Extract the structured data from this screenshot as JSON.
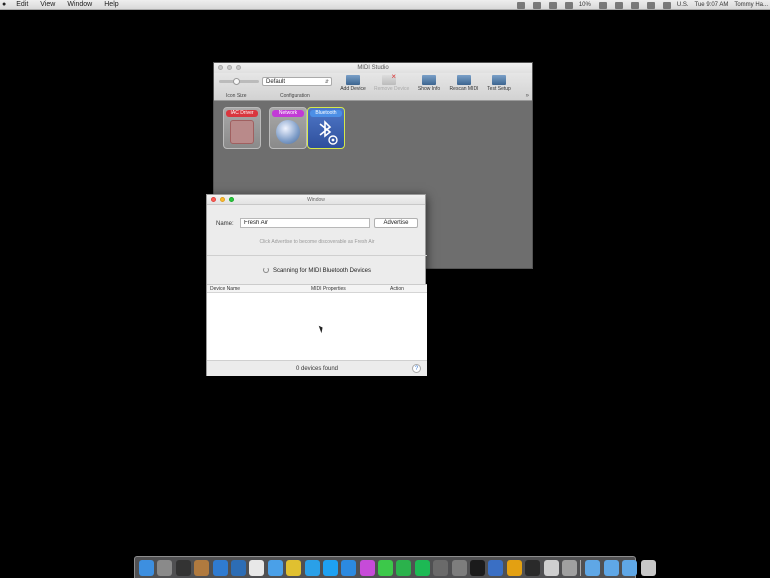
{
  "menubar": {
    "items": [
      "Edit",
      "View",
      "Window",
      "Help"
    ],
    "battery": "10%",
    "input_source": "U.S.",
    "clock": "Tue 9:07 AM",
    "user": "Tommy Ha..."
  },
  "midi_studio": {
    "title": "MIDI Studio",
    "icon_size_label": "Icon Size",
    "configuration_label": "Configuration",
    "configuration_value": "Default",
    "toolbar_buttons": [
      {
        "label": "Add Device",
        "enabled": true
      },
      {
        "label": "Remove Device",
        "enabled": false
      },
      {
        "label": "Show Info",
        "enabled": true
      },
      {
        "label": "Rescan MIDI",
        "enabled": true
      },
      {
        "label": "Test Setup",
        "enabled": true
      }
    ],
    "overflow": "»",
    "devices": [
      {
        "label": "IAC Driver",
        "color": "#d9363e",
        "icon": "iac-driver-icon"
      },
      {
        "label": "Network",
        "color": "#c23ad6",
        "icon": "network-globe-icon"
      },
      {
        "label": "Bluetooth",
        "color": "#4c8fe6",
        "icon": "bluetooth-icon"
      }
    ]
  },
  "bluetooth_window": {
    "title": "Window",
    "name_label": "Name:",
    "name_value": "Fresh Air",
    "advertise_button": "Advertise",
    "hint": "Click Advertise to become discoverable as Fresh Air",
    "scanning": "Scanning for MIDI Bluetooth Devices",
    "columns": [
      "Device Name",
      "MIDI Properties",
      "Action"
    ],
    "devices_found": "0 devices found",
    "help": "?"
  },
  "dock": {
    "items": [
      "finder-icon",
      "launchpad-icon",
      "mission-control-icon",
      "contacts-icon",
      "safari-icon",
      "xcode-icon",
      "calendar-icon",
      "mail-icon",
      "chrome-icon",
      "skype-icon",
      "twitter-icon",
      "app-store-icon",
      "itunes-icon",
      "messages-icon",
      "facetime-icon",
      "spotify-icon",
      "midi-icon",
      "system-preferences-icon",
      "terminal-icon",
      "instruments-icon",
      "garageband-icon",
      "logic-icon",
      "piano-icon",
      "music-stand-icon",
      "folder-applications-icon",
      "folder-documents-icon",
      "downloads-icon",
      "trash-icon"
    ],
    "colors": [
      "#3d8fe0",
      "#8a8a8a",
      "#333333",
      "#b07a3f",
      "#2f7bd1",
      "#2d6db5",
      "#e8e8e8",
      "#4aa0e8",
      "#e0c030",
      "#2aa0e8",
      "#1da1f2",
      "#2c8ae0",
      "#c64bd8",
      "#3cc84a",
      "#2bb24c",
      "#1db954",
      "#6a6a6a",
      "#7d7d7d",
      "#1b1b1b",
      "#3a6fc4",
      "#e3a012",
      "#2a2a2a",
      "#cfcfcf",
      "#a0a0a0",
      "#5fa7e6",
      "#5fa7e6",
      "#5fa7e6",
      "#c8c8c8"
    ]
  }
}
